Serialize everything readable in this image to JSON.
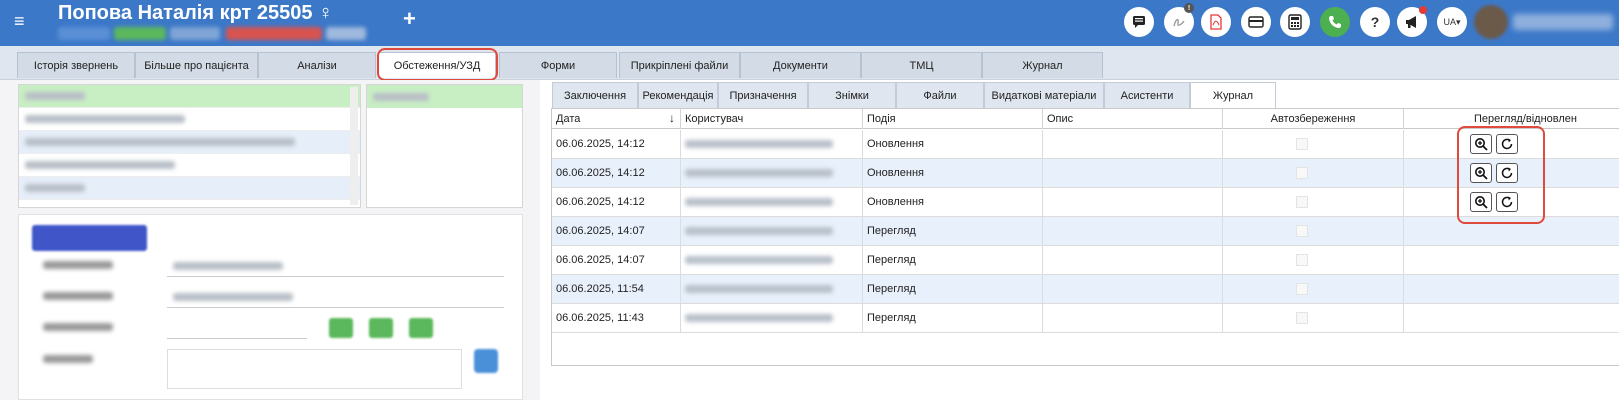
{
  "header": {
    "menu_icon": "hamburger-menu-icon",
    "patient_title": "Попова Наталія крт 25505 ♀",
    "add_icon": "plus-icon",
    "icons": [
      "chat-icon",
      "signature-icon",
      "pdf-icon",
      "card-icon",
      "calculator-icon",
      "phone-icon",
      "help-icon",
      "megaphone-icon"
    ],
    "language": "UA",
    "accent_color": "#3c78c8"
  },
  "top_tabs": [
    "Історія звернень",
    "Більше про пацієнта",
    "Аналізи",
    "Обстеження/УЗД",
    "Форми",
    "Прикріплені файли",
    "Документи",
    "ТМЦ",
    "Журнал"
  ],
  "active_top_tab": "Обстеження/УЗД",
  "sub_tabs": [
    "Заключення",
    "Рекомендація",
    "Призначення",
    "Знімки",
    "Файли",
    "Видаткові матеріали",
    "Асистенти",
    "Журнал"
  ],
  "active_sub_tab": "Журнал",
  "grid": {
    "columns": {
      "date": "Дата",
      "user": "Користувач",
      "event": "Подія",
      "description": "Опис",
      "autosave": "Автозбереження",
      "view_restore": "Перегляд/відновлен"
    },
    "rows": [
      {
        "date": "06.06.2025, 14:12",
        "event": "Оновлення",
        "has_actions": true
      },
      {
        "date": "06.06.2025, 14:12",
        "event": "Оновлення",
        "has_actions": true
      },
      {
        "date": "06.06.2025, 14:12",
        "event": "Оновлення",
        "has_actions": true
      },
      {
        "date": "06.06.2025, 14:07",
        "event": "Перегляд",
        "has_actions": false
      },
      {
        "date": "06.06.2025, 14:07",
        "event": "Перегляд",
        "has_actions": false
      },
      {
        "date": "06.06.2025, 11:54",
        "event": "Перегляд",
        "has_actions": false
      },
      {
        "date": "06.06.2025, 11:43",
        "event": "Перегляд",
        "has_actions": false
      }
    ],
    "action_icons": [
      "zoom-in-icon",
      "refresh-icon"
    ]
  },
  "colors": {
    "highlight_outline": "#e04a3c",
    "selected_green": "#c8eec4",
    "row_alt": "#e8f0fb"
  }
}
